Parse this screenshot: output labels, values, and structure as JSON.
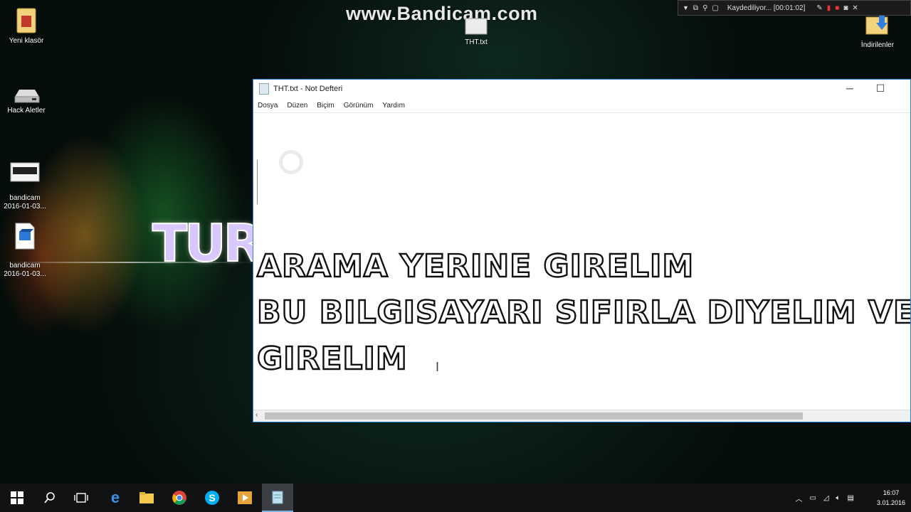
{
  "watermark": "www.Bandicam.com",
  "bandicam_bar": {
    "status": "Kaydediliyor... [00:01:02]"
  },
  "desktop_icons": [
    {
      "label": "Yeni klasör",
      "icon": "folder-icon"
    },
    {
      "label": "Hack Aletler",
      "icon": "drive-icon"
    },
    {
      "label": "bandicam\n2016-01-03...",
      "icon": "image-file-icon"
    },
    {
      "label": "bandicam\n2016-01-03...",
      "icon": "video-file-icon"
    },
    {
      "label": "THT.txt",
      "icon": "text-file-icon"
    },
    {
      "label": "İndirilenler",
      "icon": "downloads-folder-icon"
    }
  ],
  "wallpaper_logo": "TUR",
  "notepad": {
    "title": "THT.txt - Not Defteri",
    "menu": [
      "Dosya",
      "Düzen",
      "Biçim",
      "Görünüm",
      "Yardım"
    ],
    "lines": [
      "ARAMA YERINE GIRELIM",
      "BU BILGISAYARI SIFIRLA DIYELIM VE",
      "GIRELIM"
    ],
    "scroll_left": "‹"
  },
  "taskbar": {
    "items": [
      "start-icon",
      "search-icon",
      "task-view-icon",
      "edge-icon",
      "file-explorer-icon",
      "chrome-icon",
      "skype-icon",
      "media-player-icon",
      "notepad-icon"
    ],
    "clock_time": "16:07",
    "clock_date": "3.01.2016"
  },
  "colors": {
    "accent": "#2a86d6",
    "taskbar": "#101214"
  }
}
